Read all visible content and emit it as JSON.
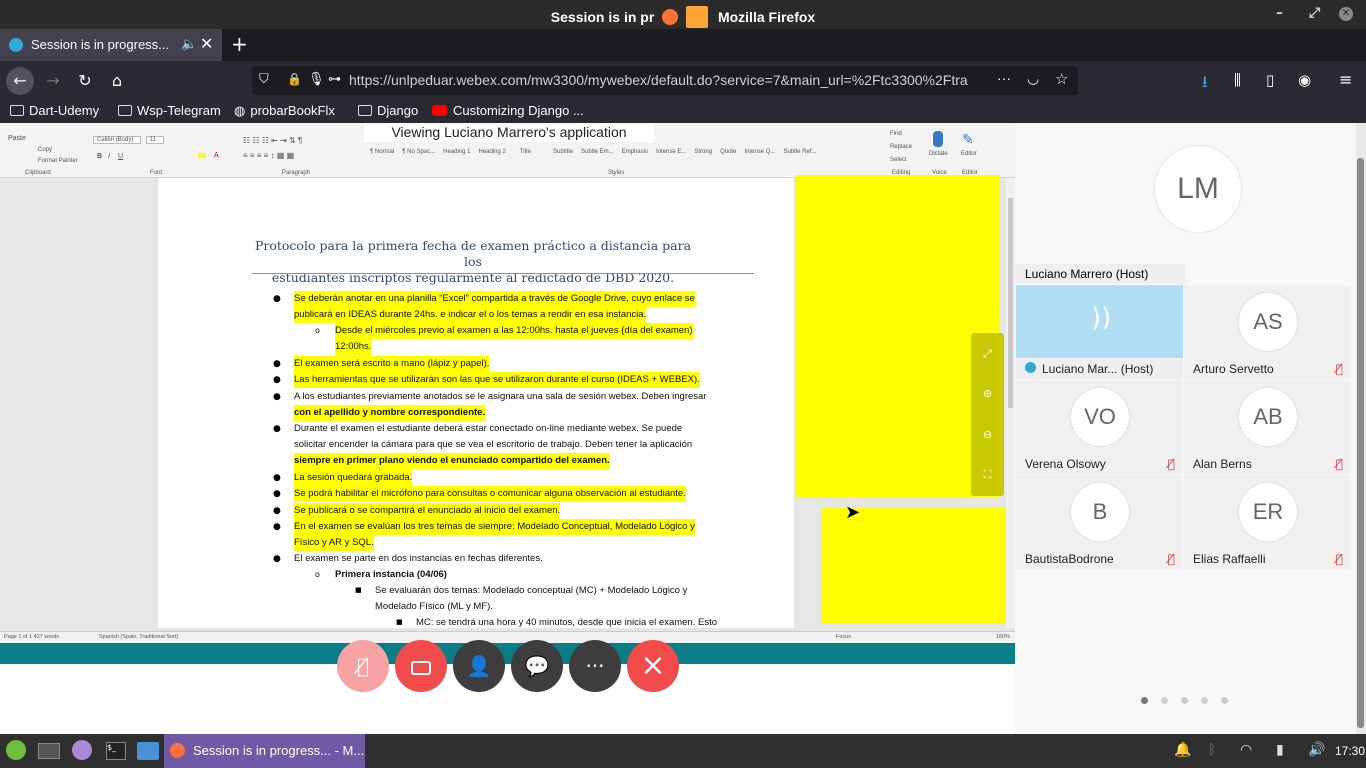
{
  "window": {
    "title": "Mozilla Firefox",
    "title_left": "Session is in pr"
  },
  "tab": {
    "label": "Session is in progress..."
  },
  "nav": {
    "url": "https://unlpeduar.webex.com/mw3300/mywebex/default.do?service=7&main_url=%2Ftc3300%2Ftra"
  },
  "bookmarks": [
    "Dart-Udemy",
    "Wsp-Telegram",
    "probarBookFlx",
    "Django",
    "Customizing Django ..."
  ],
  "share": {
    "banner": "Viewing Luciano Marrero's application",
    "ribbon_font": "Calibri (Body)",
    "ribbon_size": "11",
    "styles": [
      "¶ Normal",
      "¶ No Spac...",
      "Heading 1",
      "Heading 2",
      "Title",
      "Subtitle",
      "Subtle Em...",
      "Emphasis",
      "Intense E...",
      "Strong",
      "Quote",
      "Intense Q...",
      "Subtle Ref..."
    ],
    "groups": [
      "Clipboard",
      "Font",
      "Paragraph",
      "Styles",
      "Editing",
      "Voice",
      "Editor"
    ],
    "ribbon_buttons": {
      "paste": "Paste",
      "copy": "Copy",
      "format_painter": "Format Painter",
      "find": "Find",
      "replace": "Replace",
      "select": "Select",
      "dictate": "Dictate",
      "editor": "Editor"
    },
    "doc_title_1": "Protocolo para la primera fecha de examen práctico a distancia para los",
    "doc_title_2": "estudiantes inscriptos regularmente al redictado de DBD 2020.",
    "lines": [
      "Se deberán anotar en una planilla “Excel” compartida a través de Google Drive, cuyo enlace se",
      "publicará en IDEAS durante 24hs. e indicar el o los temas a rendir en esa instancia.",
      "Desde el miércoles previo al examen a las 12:00hs. hasta el jueves (día del examen)",
      "12:00hs.",
      "El examen será escrito a mano (lápiz y papel).",
      "Las herramientas que se utilizarán son las que se utilizaron durante el curso (IDEAS + WEBEX).",
      "A los estudiantes previamente anotados se le asignara una sala de sesión webex. Deben ingresar",
      "con el apellido y nombre correspondiente.",
      "Durante el examen el estudiante deberá estar conectado on-line mediante webex. Se puede",
      "solicitar encender la cámara para que se vea el escritorio de trabajo. Deben tener la aplicación",
      "siempre en primer plano viendo el enunciado compartido del examen.",
      "La sesión quedará grabada.",
      "Se podrá habilitar el micrófono para consultas o comunicar alguna observación al estudiante.",
      "Se publicará o se compartirá el enunciado al inicio del examen.",
      "En el examen se evalúan los tres temas de siempre: Modelado Conceptual, Modelado Lógico y",
      "Físico y AR y SQL.",
      "El examen se parte en dos instancias en fechas diferentes.",
      "Primera instancia (04/06)",
      "Se evaluarán dos temas: Modelado conceptual (MC) + Modelado Lógico y",
      "Modelado Físico (ML y MF).",
      "MC: se tendrá una hora y 40 minutos, desde que inicia el examen. Esto"
    ],
    "status_left": "Page 1 of 1     427 words",
    "status_lang": "Spanish (Spain, Traditional Sort)",
    "status_focus": "Focus",
    "zoom": "160%"
  },
  "controls": {
    "mute": "mic-off-icon",
    "video": "video-off-icon",
    "participants": "participants-icon",
    "chat": "chat-icon",
    "more": "···",
    "end": "×"
  },
  "panel": {
    "host_initials": "LM",
    "host_label": "Luciano Marrero (Host)",
    "tiles": [
      {
        "initials": "",
        "name": "Luciano Mar...  (Host)",
        "muted": false
      },
      {
        "initials": "AS",
        "name": "Arturo Servetto",
        "muted": true
      },
      {
        "initials": "VO",
        "name": "Verena Olsowy",
        "muted": true
      },
      {
        "initials": "AB",
        "name": "Alan Berns",
        "muted": true
      },
      {
        "initials": "B",
        "name": "BautistaBodrone",
        "muted": true
      },
      {
        "initials": "ER",
        "name": "Elias Raffaelli",
        "muted": true
      }
    ],
    "pages": 5
  },
  "taskbar": {
    "active": "Session is in progress... - M...",
    "clock": "17:30"
  },
  "colors": {
    "highlight": "#ffff00",
    "teal": "#0a7e86",
    "end_red": "#f24b4b",
    "mute_pink": "#f5a3a3"
  }
}
